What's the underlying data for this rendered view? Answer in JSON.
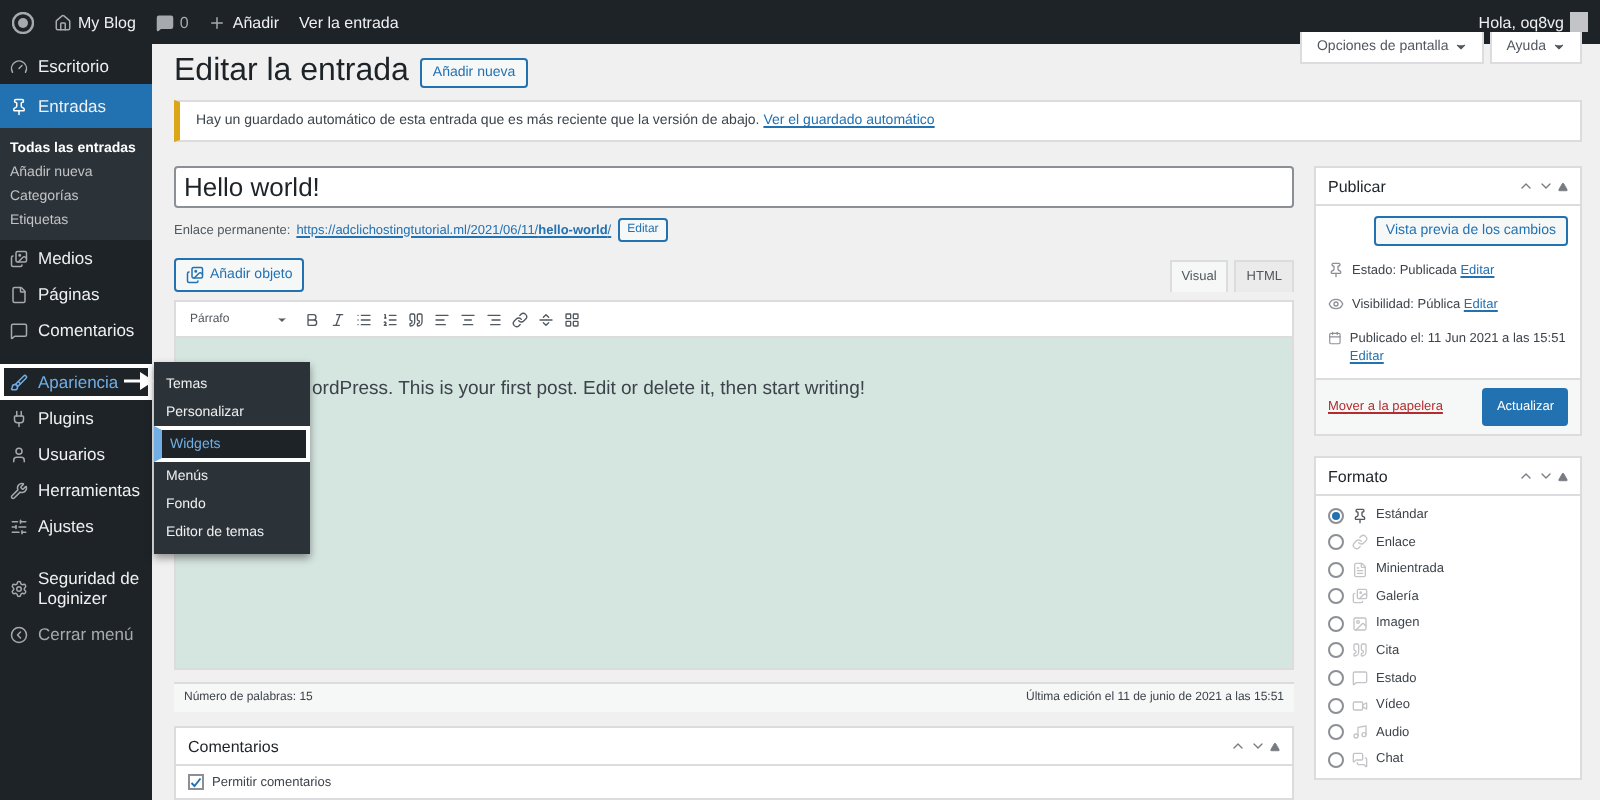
{
  "admin_bar": {
    "site": "My Blog",
    "comments": "0",
    "new": "Añadir",
    "view": "Ver la entrada",
    "greeting": "Hola, oq8vg"
  },
  "screen_meta": [
    "Opciones de pantalla",
    "Ayuda"
  ],
  "sidebar": {
    "items": [
      {
        "label": "Escritorio",
        "kind": "menu",
        "selected": false,
        "highlighted": false
      },
      {
        "label": "Entradas",
        "kind": "menu",
        "selected": true,
        "highlighted": false,
        "children": [
          {
            "label": "Todas las entradas",
            "selected": true
          },
          {
            "label": "Añadir nueva",
            "selected": false
          },
          {
            "label": "Categorías",
            "selected": false
          },
          {
            "label": "Etiquetas",
            "selected": false
          }
        ]
      },
      {
        "label": "Medios",
        "kind": "menu",
        "selected": false,
        "highlighted": false
      },
      {
        "label": "Páginas",
        "kind": "menu",
        "selected": false,
        "highlighted": false
      },
      {
        "label": "Comentarios",
        "kind": "menu",
        "selected": false,
        "highlighted": false
      },
      {
        "label": "Apariencia",
        "kind": "menu",
        "selected": false,
        "highlighted": true
      },
      {
        "label": "Plugins",
        "kind": "menu",
        "selected": false,
        "highlighted": false
      },
      {
        "label": "Usuarios",
        "kind": "menu",
        "selected": false,
        "highlighted": false
      },
      {
        "label": "Herramientas",
        "kind": "menu",
        "selected": false,
        "highlighted": false
      },
      {
        "label": "Ajustes",
        "kind": "menu",
        "selected": false,
        "highlighted": false
      },
      {
        "label": "Seguridad de Loginizer",
        "kind": "menu",
        "selected": false,
        "highlighted": false
      },
      {
        "label": "Cerrar menú",
        "kind": "collapse",
        "selected": false,
        "highlighted": false
      }
    ]
  },
  "flyout": [
    {
      "label": "Temas",
      "highlighted": false
    },
    {
      "label": "Personalizar",
      "highlighted": false
    },
    {
      "label": "Widgets",
      "highlighted": true
    },
    {
      "label": "Menús",
      "highlighted": false
    },
    {
      "label": "Fondo",
      "highlighted": false
    },
    {
      "label": "Editor de temas",
      "highlighted": false
    }
  ],
  "page": {
    "title": "Editar la entrada",
    "add_new": "Añadir nueva"
  },
  "notice": {
    "text": "Hay un guardado automático de esta entrada que es más reciente que la versión de abajo.",
    "link": "Ver el guardado automático"
  },
  "post_title": "Hello world!",
  "permalink": {
    "label": "Enlace permanente:",
    "url": "https://adclichostingtutorial.ml/2021/06/11/**hello-world**/",
    "edit": "Editar"
  },
  "add_media": "Añadir objeto",
  "editor_tabs": [
    {
      "label": "Visual",
      "selected": true
    },
    {
      "label": "HTML",
      "selected": false
    }
  ],
  "format_select": "Párrafo",
  "content": "ordPress. This is your first post. Edit or delete it, then start writing!",
  "word_count": "Número de palabras: 15",
  "last_edit": "Última edición el 11 de junio de 2021 a las 15:51",
  "comments_box": {
    "title": "Comentarios",
    "checkbox": {
      "label": "Permitir comentarios",
      "checked": true
    }
  },
  "publish": {
    "title": "Publicar",
    "preview": "Vista previa de los cambios",
    "rows": [
      {
        "text": "Estado: Publicada",
        "link": "Editar"
      },
      {
        "text": "Visibilidad: Pública",
        "link": "Editar"
      },
      {
        "text": "Publicado el: 11 Jun 2021 a las 15:51",
        "link": "Editar"
      }
    ],
    "trash": "Mover a la papelera",
    "update": "Actualizar"
  },
  "format_box": {
    "title": "Formato",
    "options": [
      {
        "label": "Estándar",
        "selected": true
      },
      {
        "label": "Enlace",
        "selected": false
      },
      {
        "label": "Minientrada",
        "selected": false
      },
      {
        "label": "Galería",
        "selected": false
      },
      {
        "label": "Imagen",
        "selected": false
      },
      {
        "label": "Cita",
        "selected": false
      },
      {
        "label": "Estado",
        "selected": false
      },
      {
        "label": "Vídeo",
        "selected": false
      },
      {
        "label": "Audio",
        "selected": false
      },
      {
        "label": "Chat",
        "selected": false
      }
    ]
  }
}
